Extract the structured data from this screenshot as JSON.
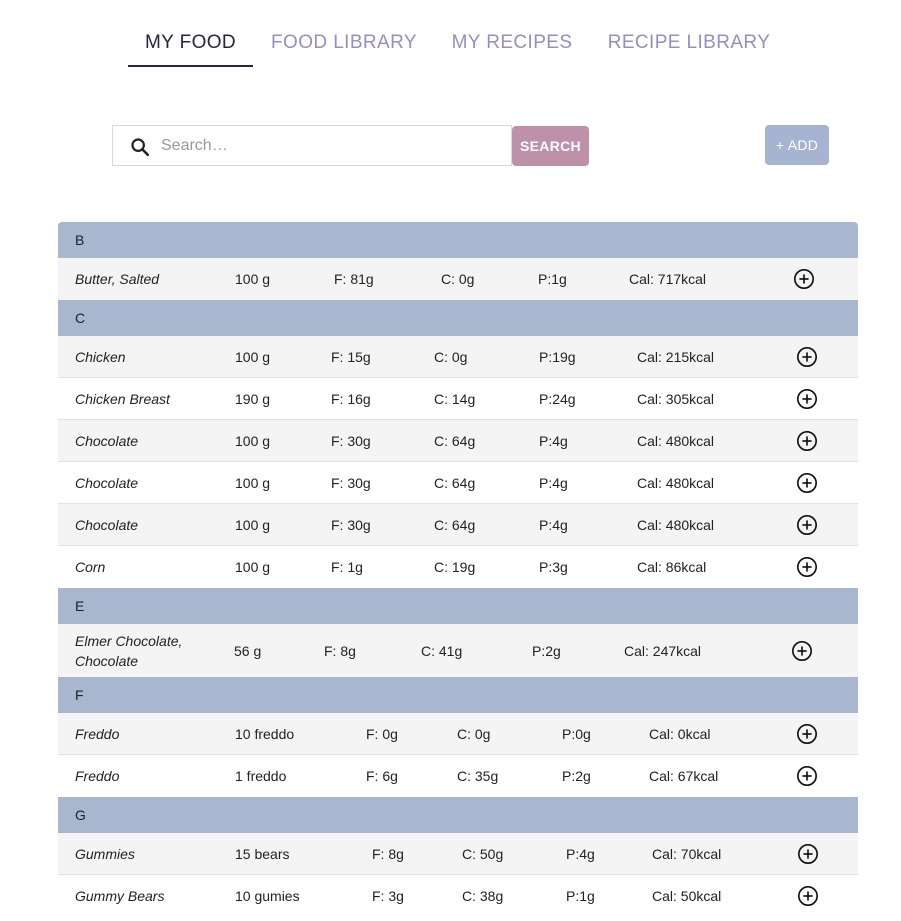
{
  "tabs": [
    {
      "label": "MY FOOD",
      "active": true
    },
    {
      "label": "FOOD LIBRARY",
      "active": false
    },
    {
      "label": "MY RECIPES",
      "active": false
    },
    {
      "label": "RECIPE LIBRARY",
      "active": false
    }
  ],
  "search": {
    "placeholder": "Search…",
    "value": "",
    "button_label": "SEARCH"
  },
  "add_button": {
    "label": "+ ADD"
  },
  "colors": {
    "accent_search": "#bf90a9",
    "accent_add": "#a6b4d2",
    "group_header": "#a8b6d0"
  },
  "groups": [
    {
      "letter": "B",
      "items": [
        {
          "name": "Butter, Salted",
          "amount": "100 g",
          "fat": "F: 81g",
          "carbs": "C: 0g",
          "protein": "P:1g",
          "cal": "Cal: 717kcal"
        }
      ]
    },
    {
      "letter": "C",
      "items": [
        {
          "name": "Chicken",
          "amount": "100 g",
          "fat": "F: 15g",
          "carbs": "C: 0g",
          "protein": "P:19g",
          "cal": "Cal: 215kcal"
        },
        {
          "name": "Chicken Breast",
          "amount": "190 g",
          "fat": "F: 16g",
          "carbs": "C: 14g",
          "protein": "P:24g",
          "cal": "Cal: 305kcal"
        },
        {
          "name": "Chocolate",
          "amount": "100 g",
          "fat": "F: 30g",
          "carbs": "C: 64g",
          "protein": "P:4g",
          "cal": "Cal: 480kcal"
        },
        {
          "name": "Chocolate",
          "amount": "100 g",
          "fat": "F: 30g",
          "carbs": "C: 64g",
          "protein": "P:4g",
          "cal": "Cal: 480kcal"
        },
        {
          "name": "Chocolate",
          "amount": "100 g",
          "fat": "F: 30g",
          "carbs": "C: 64g",
          "protein": "P:4g",
          "cal": "Cal: 480kcal"
        },
        {
          "name": "Corn",
          "amount": "100 g",
          "fat": "F: 1g",
          "carbs": "C: 19g",
          "protein": "P:3g",
          "cal": "Cal: 86kcal"
        }
      ]
    },
    {
      "letter": "E",
      "items": [
        {
          "name": "Elmer Chocolate, Chocolate",
          "amount": "56 g",
          "fat": "F: 8g",
          "carbs": "C: 41g",
          "protein": "P:2g",
          "cal": "Cal: 247kcal"
        }
      ]
    },
    {
      "letter": "F",
      "items": [
        {
          "name": "Freddo",
          "amount": "10 freddo",
          "fat": "F: 0g",
          "carbs": "C: 0g",
          "protein": "P:0g",
          "cal": "Cal: 0kcal"
        },
        {
          "name": "Freddo",
          "amount": "1 freddo",
          "fat": "F: 6g",
          "carbs": "C: 35g",
          "protein": "P:2g",
          "cal": "Cal: 67kcal"
        }
      ]
    },
    {
      "letter": "G",
      "items": [
        {
          "name": "Gummies",
          "amount": "15 bears",
          "fat": "F: 8g",
          "carbs": "C: 50g",
          "protein": "P:4g",
          "cal": "Cal: 70kcal"
        },
        {
          "name": "Gummy Bears",
          "amount": "10 gumies",
          "fat": "F: 3g",
          "carbs": "C: 38g",
          "protein": "P:1g",
          "cal": "Cal: 50kcal"
        }
      ]
    }
  ]
}
